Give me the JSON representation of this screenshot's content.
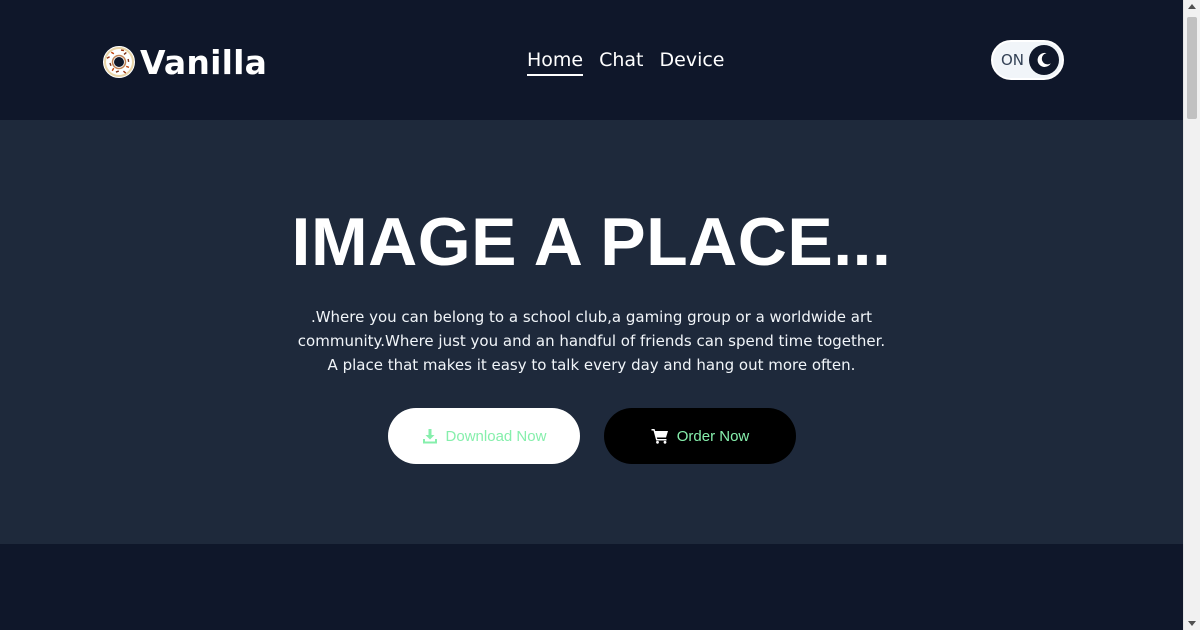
{
  "brand": {
    "name": "Vanilla",
    "logo_icon": "donut-icon"
  },
  "nav": {
    "items": [
      {
        "label": "Home",
        "active": true
      },
      {
        "label": "Chat",
        "active": false
      },
      {
        "label": "Device",
        "active": false
      }
    ]
  },
  "theme_toggle": {
    "label": "ON",
    "icon": "moon-icon"
  },
  "hero": {
    "title": "IMAGE A PLACE...",
    "text": ".Where you can belong to a school club,a gaming group or a worldwide art community.Where just you and an handful of friends can spend time together. A place that makes it easy to talk every day and hang out more often.",
    "download_label": "Download Now",
    "download_icon": "download-icon",
    "order_label": "Order Now",
    "order_icon": "cart-icon"
  },
  "colors": {
    "header_bg": "#0f172a",
    "hero_bg": "#1e293b",
    "accent_green": "#86efac"
  }
}
